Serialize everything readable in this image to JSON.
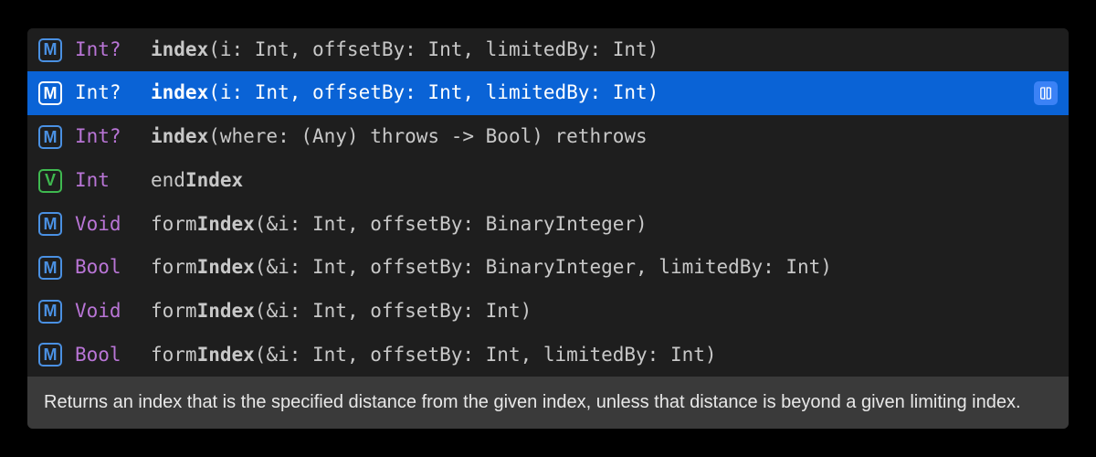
{
  "suggestions": [
    {
      "kind": "M",
      "returnType": "Int?",
      "name": "index",
      "bold": "index",
      "rest": "(i: Int, offsetBy: Int, limitedBy: Int)",
      "selected": false
    },
    {
      "kind": "M",
      "returnType": "Int?",
      "name": "index",
      "bold": "index",
      "rest": "(i: Int, offsetBy: Int, limitedBy: Int)",
      "selected": true
    },
    {
      "kind": "M",
      "returnType": "Int?",
      "name": "index",
      "bold": "index",
      "rest": "(where: (Any) throws -> Bool) rethrows",
      "selected": false
    },
    {
      "kind": "V",
      "returnType": "Int",
      "name": "endIndex",
      "preBold": "end",
      "bold": "Index",
      "rest": "",
      "selected": false
    },
    {
      "kind": "M",
      "returnType": "Void",
      "name": "formIndex",
      "preBold": "form",
      "bold": "Index",
      "rest": "(&i: Int, offsetBy: BinaryInteger)",
      "selected": false
    },
    {
      "kind": "M",
      "returnType": "Bool",
      "name": "formIndex",
      "preBold": "form",
      "bold": "Index",
      "rest": "(&i: Int, offsetBy: BinaryInteger, limitedBy: Int)",
      "selected": false
    },
    {
      "kind": "M",
      "returnType": "Void",
      "name": "formIndex",
      "preBold": "form",
      "bold": "Index",
      "rest": "(&i: Int, offsetBy: Int)",
      "selected": false
    },
    {
      "kind": "M",
      "returnType": "Bool",
      "name": "formIndex",
      "preBold": "form",
      "bold": "Index",
      "rest": "(&i: Int, offsetBy: Int, limitedBy: Int)",
      "selected": false
    }
  ],
  "description": "Returns an index that is the specified distance from the given index, unless that distance is beyond a given limiting index."
}
